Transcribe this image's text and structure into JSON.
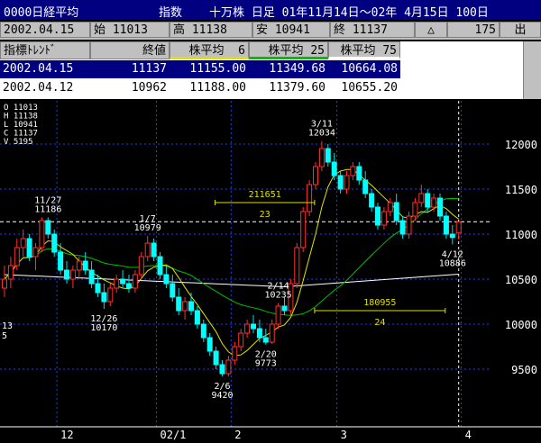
{
  "title_bar": {
    "code": "0000日経平均",
    "kind": "指数",
    "description": "十万株 日足 01年11月14日～02年 4月15日 100日"
  },
  "summary": {
    "date": "2002.04.15",
    "open": "始 11013",
    "high": "高 11138",
    "low": "安 10941",
    "close": "終 11137",
    "change_symbol": "△",
    "change": "175",
    "exit_label": "出"
  },
  "table": {
    "headers": [
      "指標ﾄﾚﾝﾄﾞ",
      "終値",
      "株平均  6",
      "株平均 25",
      "株平均 75"
    ],
    "rows": [
      [
        "2002.04.15",
        "11137",
        "11155.00",
        "11349.68",
        "10664.08"
      ],
      [
        "2002.04.12",
        "10962",
        "11188.00",
        "11379.60",
        "10655.20"
      ]
    ]
  },
  "info_box": [
    "O 11013",
    "H 11138",
    "L 10941",
    "C 11137",
    "V  5195"
  ],
  "chart_data": {
    "type": "candlestick",
    "ylim": [
      9300,
      12100
    ],
    "yticks": [
      9500,
      10000,
      10500,
      11000,
      11500,
      12000
    ],
    "xticks": [
      "12",
      "02/1",
      "2",
      "3",
      "4"
    ],
    "cursor_level": 11137,
    "candles": [
      [
        10400,
        10650,
        10300,
        10500
      ],
      [
        10500,
        10750,
        10400,
        10650
      ],
      [
        10650,
        10950,
        10600,
        10850
      ],
      [
        10850,
        11050,
        10750,
        10950
      ],
      [
        10950,
        11000,
        10700,
        10750
      ],
      [
        10750,
        10900,
        10600,
        10850
      ],
      [
        10850,
        11186,
        10800,
        11150
      ],
      [
        11150,
        11186,
        10950,
        11000
      ],
      [
        11000,
        11050,
        10750,
        10800
      ],
      [
        10800,
        10900,
        10550,
        10600
      ],
      [
        10600,
        10700,
        10450,
        10500
      ],
      [
        10500,
        10650,
        10400,
        10600
      ],
      [
        10600,
        10750,
        10500,
        10700
      ],
      [
        10700,
        10800,
        10550,
        10600
      ],
      [
        10600,
        10700,
        10400,
        10450
      ],
      [
        10450,
        10550,
        10300,
        10350
      ],
      [
        10350,
        10450,
        10170,
        10250
      ],
      [
        10250,
        10450,
        10200,
        10400
      ],
      [
        10400,
        10550,
        10350,
        10500
      ],
      [
        10500,
        10600,
        10400,
        10450
      ],
      [
        10450,
        10550,
        10350,
        10400
      ],
      [
        10400,
        10600,
        10350,
        10550
      ],
      [
        10550,
        10800,
        10500,
        10750
      ],
      [
        10750,
        10979,
        10700,
        10900
      ],
      [
        10900,
        10950,
        10700,
        10750
      ],
      [
        10750,
        10800,
        10500,
        10550
      ],
      [
        10550,
        10650,
        10400,
        10450
      ],
      [
        10450,
        10550,
        10250,
        10300
      ],
      [
        10300,
        10400,
        10100,
        10150
      ],
      [
        10150,
        10300,
        10050,
        10250
      ],
      [
        10250,
        10350,
        10100,
        10150
      ],
      [
        10150,
        10200,
        9950,
        10000
      ],
      [
        10000,
        10050,
        9800,
        9850
      ],
      [
        9850,
        9900,
        9650,
        9700
      ],
      [
        9700,
        9750,
        9500,
        9550
      ],
      [
        9550,
        9600,
        9420,
        9450
      ],
      [
        9450,
        9650,
        9420,
        9600
      ],
      [
        9600,
        9800,
        9550,
        9750
      ],
      [
        9750,
        9950,
        9700,
        9900
      ],
      [
        9900,
        10050,
        9850,
        10000
      ],
      [
        10000,
        10100,
        9900,
        9950
      ],
      [
        9950,
        10050,
        9800,
        9850
      ],
      [
        9850,
        9950,
        9773,
        9800
      ],
      [
        9800,
        10050,
        9780,
        10000
      ],
      [
        10000,
        10235,
        9950,
        10200
      ],
      [
        10200,
        10300,
        10100,
        10150
      ],
      [
        10150,
        10500,
        10100,
        10450
      ],
      [
        10450,
        10900,
        10400,
        10850
      ],
      [
        10850,
        11300,
        10800,
        11250
      ],
      [
        11250,
        11600,
        11200,
        11550
      ],
      [
        11550,
        11800,
        11500,
        11750
      ],
      [
        11750,
        12034,
        11700,
        11950
      ],
      [
        11950,
        12000,
        11750,
        11800
      ],
      [
        11800,
        11900,
        11600,
        11650
      ],
      [
        11650,
        11700,
        11450,
        11500
      ],
      [
        11500,
        11700,
        11450,
        11650
      ],
      [
        11650,
        11800,
        11600,
        11750
      ],
      [
        11750,
        11800,
        11550,
        11600
      ],
      [
        11600,
        11700,
        11400,
        11450
      ],
      [
        11450,
        11500,
        11250,
        11300
      ],
      [
        11300,
        11350,
        11050,
        11100
      ],
      [
        11100,
        11300,
        11050,
        11250
      ],
      [
        11250,
        11400,
        11200,
        11350
      ],
      [
        11350,
        11450,
        11100,
        11150
      ],
      [
        11150,
        11200,
        10950,
        11000
      ],
      [
        11000,
        11250,
        10950,
        11200
      ],
      [
        11200,
        11400,
        11150,
        11350
      ],
      [
        11350,
        11550,
        11300,
        11450
      ],
      [
        11450,
        11500,
        11250,
        11300
      ],
      [
        11300,
        11450,
        11250,
        11400
      ],
      [
        11400,
        11450,
        11150,
        11200
      ],
      [
        11200,
        11250,
        10950,
        11000
      ],
      [
        11000,
        11100,
        10886,
        10962
      ],
      [
        11013,
        11138,
        10941,
        11137
      ]
    ],
    "annotations": [
      {
        "index": 7,
        "price": 11186,
        "line1": "11/27",
        "line2": "11186",
        "pos": "above"
      },
      {
        "index": 16,
        "price": 10170,
        "line1": "12/26",
        "line2": "10170",
        "pos": "below"
      },
      {
        "index": 23,
        "price": 10979,
        "line1": "1/7",
        "line2": "10979",
        "pos": "above"
      },
      {
        "index": 35,
        "price": 9420,
        "line1": "2/6",
        "line2": "9420",
        "pos": "below"
      },
      {
        "index": 42,
        "price": 9773,
        "line1": "2/20",
        "line2": "9773",
        "pos": "below"
      },
      {
        "index": 44,
        "price": 10235,
        "line1": "2/14",
        "line2": "10235",
        "pos": "above"
      },
      {
        "index": 51,
        "price": 12034,
        "line1": "3/11",
        "line2": "12034",
        "pos": "above"
      },
      {
        "index": 72,
        "price": 10886,
        "line1": "4/12",
        "line2": "10886",
        "pos": "below"
      }
    ],
    "measures": [
      {
        "from": 35,
        "to": 51,
        "price": 11350,
        "value": "211651",
        "days": "23"
      },
      {
        "from": 51,
        "to": 72,
        "price": 10150,
        "value": "180955",
        "days": "24"
      }
    ],
    "left_labels": [
      "13",
      "5"
    ]
  }
}
